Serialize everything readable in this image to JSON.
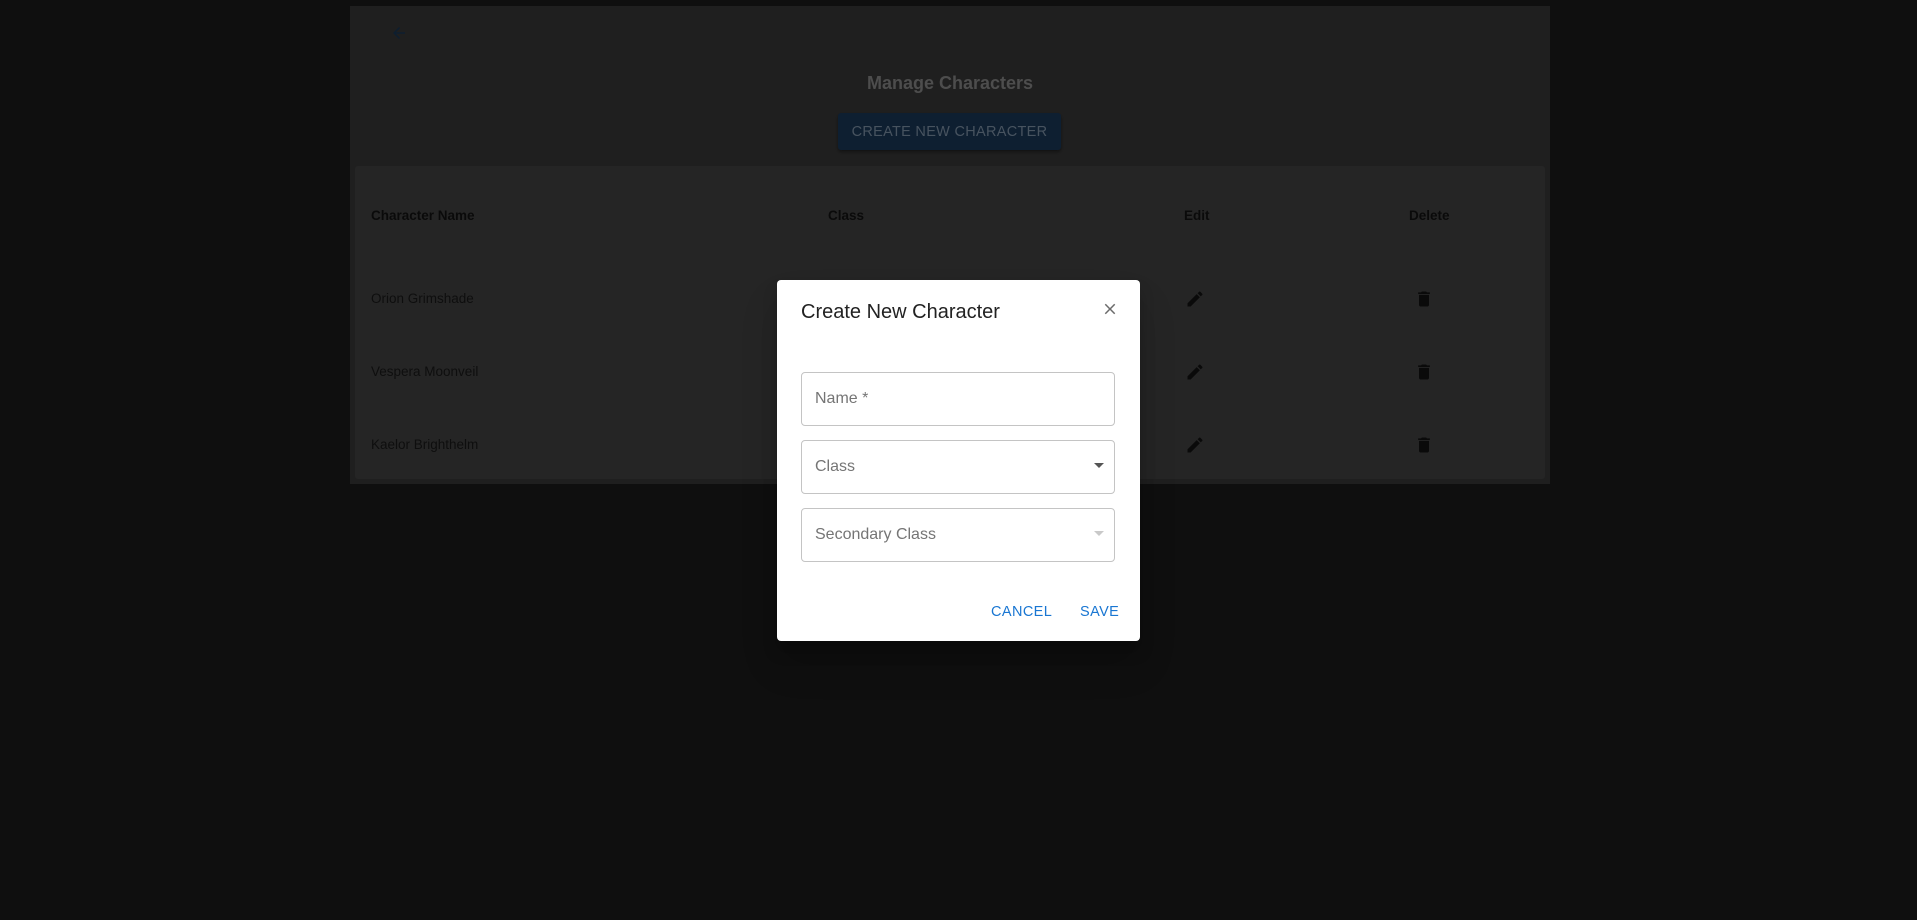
{
  "page": {
    "title": "Manage Characters",
    "create_button_label": "CREATE NEW CHARACTER",
    "back_icon": "arrow-left-icon"
  },
  "table": {
    "headers": [
      "Character Name",
      "Class",
      "Edit",
      "Delete"
    ],
    "rows": [
      {
        "name": "Orion Grimshade"
      },
      {
        "name": "Vespera Moonveil"
      },
      {
        "name": "Kaelor Brighthelm"
      }
    ],
    "edit_icon": "pencil-icon",
    "delete_icon": "trash-icon"
  },
  "dialog": {
    "title": "Create New Character",
    "close_icon": "close-icon",
    "name_label": "Name *",
    "class_label": "Class",
    "secondary_class_label": "Secondary Class",
    "cancel_label": "CANCEL",
    "save_label": "SAVE"
  },
  "colors": {
    "accent": "#1976d2",
    "page_background": "#1f1f1f",
    "panel_background": "#3f3f3f"
  }
}
